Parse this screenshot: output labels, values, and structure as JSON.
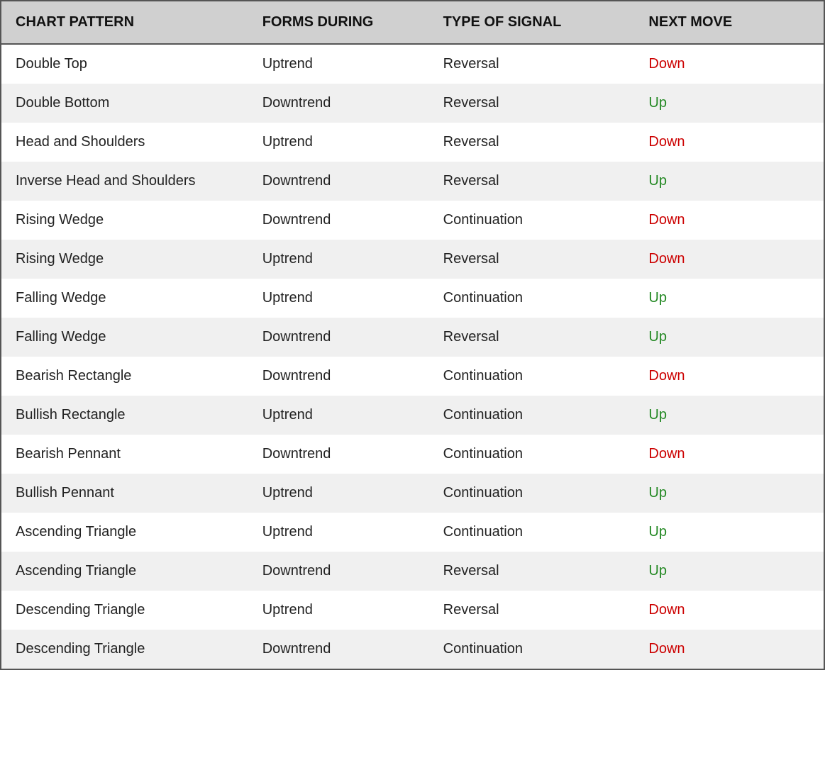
{
  "header": {
    "col1": "CHART PATTERN",
    "col2": "FORMS DURING",
    "col3": "TYPE OF SIGNAL",
    "col4": "NEXT MOVE"
  },
  "rows": [
    {
      "pattern": "Double Top",
      "forms": "Uptrend",
      "signal": "Reversal",
      "next": "Down",
      "next_color": "down"
    },
    {
      "pattern": "Double Bottom",
      "forms": "Downtrend",
      "signal": "Reversal",
      "next": "Up",
      "next_color": "up"
    },
    {
      "pattern": "Head and Shoulders",
      "forms": "Uptrend",
      "signal": "Reversal",
      "next": "Down",
      "next_color": "down"
    },
    {
      "pattern": "Inverse Head and Shoulders",
      "forms": "Downtrend",
      "signal": "Reversal",
      "next": "Up",
      "next_color": "up"
    },
    {
      "pattern": "Rising Wedge",
      "forms": "Downtrend",
      "signal": "Continuation",
      "next": "Down",
      "next_color": "down"
    },
    {
      "pattern": "Rising Wedge",
      "forms": "Uptrend",
      "signal": "Reversal",
      "next": "Down",
      "next_color": "down"
    },
    {
      "pattern": "Falling Wedge",
      "forms": "Uptrend",
      "signal": "Continuation",
      "next": "Up",
      "next_color": "up"
    },
    {
      "pattern": "Falling Wedge",
      "forms": "Downtrend",
      "signal": "Reversal",
      "next": "Up",
      "next_color": "up"
    },
    {
      "pattern": "Bearish Rectangle",
      "forms": "Downtrend",
      "signal": "Continuation",
      "next": "Down",
      "next_color": "down"
    },
    {
      "pattern": "Bullish Rectangle",
      "forms": "Uptrend",
      "signal": "Continuation",
      "next": "Up",
      "next_color": "up"
    },
    {
      "pattern": "Bearish Pennant",
      "forms": "Downtrend",
      "signal": "Continuation",
      "next": "Down",
      "next_color": "down"
    },
    {
      "pattern": "Bullish Pennant",
      "forms": "Uptrend",
      "signal": "Continuation",
      "next": "Up",
      "next_color": "up"
    },
    {
      "pattern": "Ascending Triangle",
      "forms": "Uptrend",
      "signal": "Continuation",
      "next": "Up",
      "next_color": "up"
    },
    {
      "pattern": "Ascending Triangle",
      "forms": "Downtrend",
      "signal": "Reversal",
      "next": "Up",
      "next_color": "up"
    },
    {
      "pattern": "Descending Triangle",
      "forms": "Uptrend",
      "signal": "Reversal",
      "next": "Down",
      "next_color": "down"
    },
    {
      "pattern": "Descending Triangle",
      "forms": "Downtrend",
      "signal": "Continuation",
      "next": "Down",
      "next_color": "down"
    }
  ]
}
